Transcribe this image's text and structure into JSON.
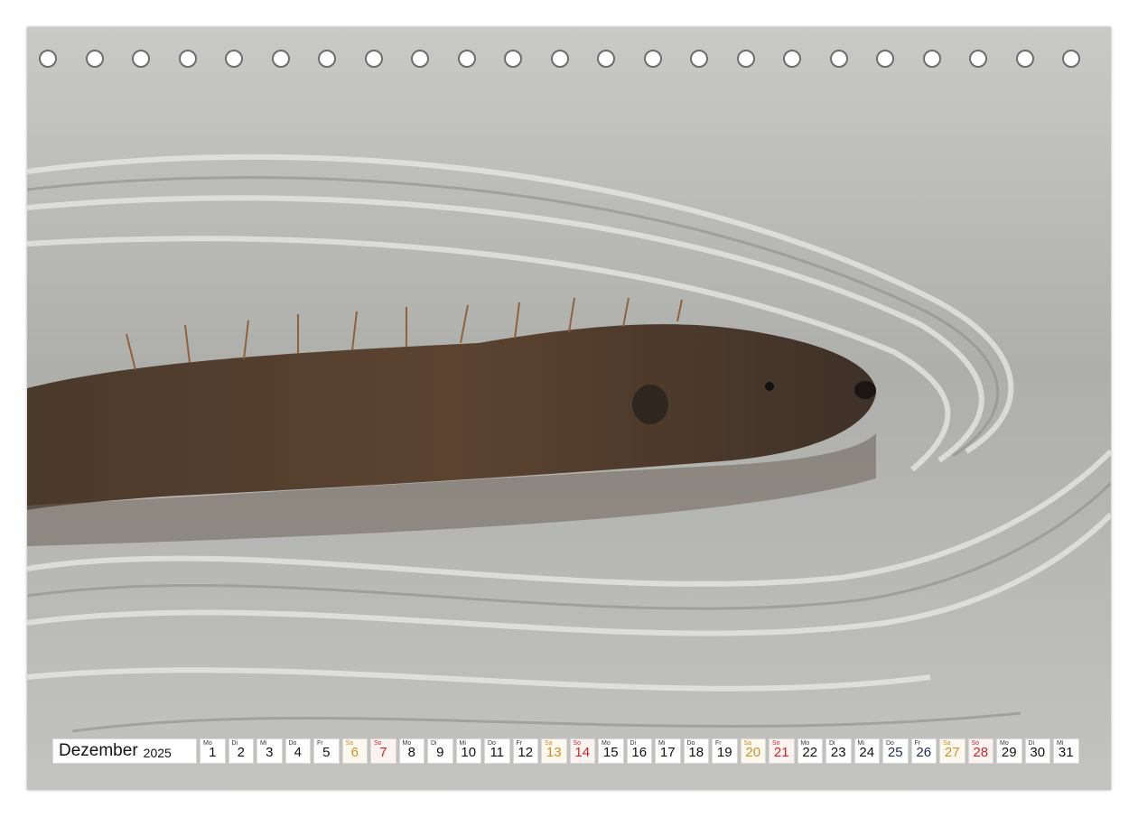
{
  "calendar": {
    "month": "Dezember",
    "year": "2025",
    "days": [
      {
        "wd": "Mo",
        "d": "1",
        "t": ""
      },
      {
        "wd": "Di",
        "d": "2",
        "t": ""
      },
      {
        "wd": "Mi",
        "d": "3",
        "t": ""
      },
      {
        "wd": "Do",
        "d": "4",
        "t": ""
      },
      {
        "wd": "Fr",
        "d": "5",
        "t": ""
      },
      {
        "wd": "Sa",
        "d": "6",
        "t": "sat"
      },
      {
        "wd": "So",
        "d": "7",
        "t": "sun"
      },
      {
        "wd": "Mo",
        "d": "8",
        "t": ""
      },
      {
        "wd": "Di",
        "d": "9",
        "t": ""
      },
      {
        "wd": "Mi",
        "d": "10",
        "t": ""
      },
      {
        "wd": "Do",
        "d": "11",
        "t": ""
      },
      {
        "wd": "Fr",
        "d": "12",
        "t": ""
      },
      {
        "wd": "Sa",
        "d": "13",
        "t": "sat"
      },
      {
        "wd": "So",
        "d": "14",
        "t": "sun"
      },
      {
        "wd": "Mo",
        "d": "15",
        "t": ""
      },
      {
        "wd": "Di",
        "d": "16",
        "t": ""
      },
      {
        "wd": "Mi",
        "d": "17",
        "t": ""
      },
      {
        "wd": "Do",
        "d": "18",
        "t": ""
      },
      {
        "wd": "Fr",
        "d": "19",
        "t": ""
      },
      {
        "wd": "Sa",
        "d": "20",
        "t": "sat"
      },
      {
        "wd": "So",
        "d": "21",
        "t": "sun"
      },
      {
        "wd": "Mo",
        "d": "22",
        "t": ""
      },
      {
        "wd": "Di",
        "d": "23",
        "t": ""
      },
      {
        "wd": "Mi",
        "d": "24",
        "t": ""
      },
      {
        "wd": "Do",
        "d": "25",
        "t": "hol"
      },
      {
        "wd": "Fr",
        "d": "26",
        "t": "hol"
      },
      {
        "wd": "Sa",
        "d": "27",
        "t": "sat"
      },
      {
        "wd": "So",
        "d": "28",
        "t": "sun"
      },
      {
        "wd": "Mo",
        "d": "29",
        "t": ""
      },
      {
        "wd": "Di",
        "d": "30",
        "t": ""
      },
      {
        "wd": "Mi",
        "d": "31",
        "t": ""
      }
    ]
  },
  "binding_holes": 23,
  "colors": {
    "saturday": "#c8902c",
    "sunday": "#c62828",
    "holiday": "#1f2a55",
    "water": "#b9b9b6",
    "fur": "#5a4330"
  },
  "photo_subject": "beaver-swimming-icon"
}
